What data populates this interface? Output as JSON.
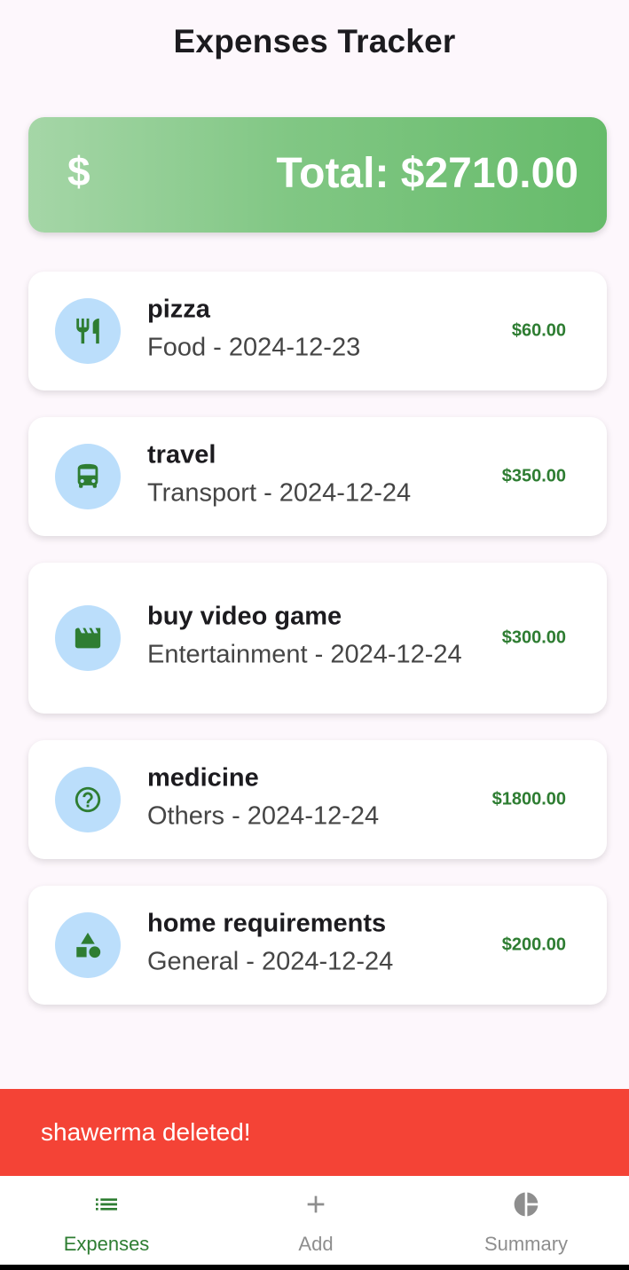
{
  "header": {
    "title": "Expenses Tracker"
  },
  "summary_card": {
    "icon": "dollar-icon",
    "icon_glyph": "$",
    "total_label": "Total: $2710.00"
  },
  "expenses": [
    {
      "name": "pizza",
      "subtitle": "Food - 2024-12-23",
      "amount": "$60.00",
      "icon": "restaurant-icon"
    },
    {
      "name": "travel",
      "subtitle": "Transport - 2024-12-24",
      "amount": "$350.00",
      "icon": "bus-icon"
    },
    {
      "name": "buy video game",
      "subtitle": "Entertainment - 2024-12-24",
      "amount": "$300.00",
      "icon": "movie-icon"
    },
    {
      "name": "medicine",
      "subtitle": "Others - 2024-12-24",
      "amount": "$1800.00",
      "icon": "help-circle-icon"
    },
    {
      "name": "home requirements",
      "subtitle": "General - 2024-12-24",
      "amount": "$200.00",
      "icon": "category-shapes-icon"
    }
  ],
  "snackbar": {
    "message": "shawerma deleted!"
  },
  "bottom_nav": {
    "items": [
      {
        "label": "Expenses",
        "icon": "list-icon",
        "selected": true
      },
      {
        "label": "Add",
        "icon": "plus-icon",
        "selected": false
      },
      {
        "label": "Summary",
        "icon": "pie-chart-icon",
        "selected": false
      }
    ]
  },
  "colors": {
    "background": "#fdf7fc",
    "accent_green": "#2e7d32",
    "icon_circle": "#bbdefb",
    "snackbar": "#f44336",
    "nav_inactive": "#8e8e8e"
  }
}
